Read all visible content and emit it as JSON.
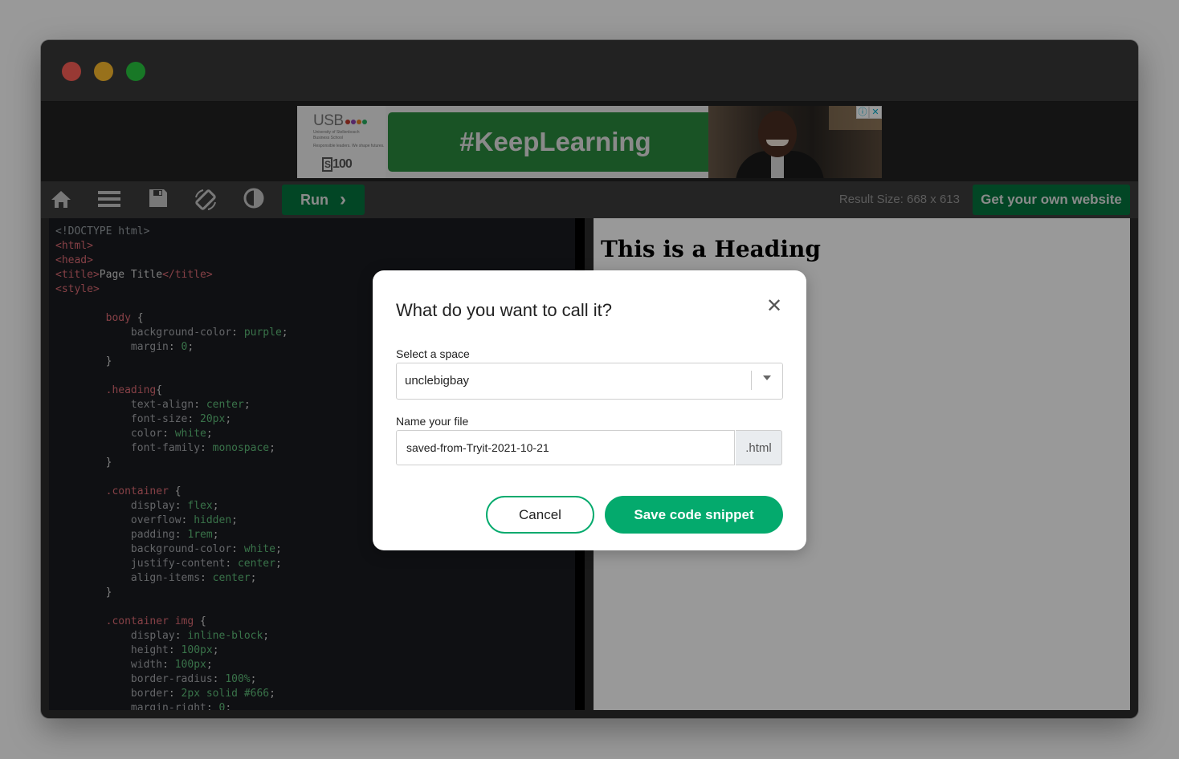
{
  "window": {
    "traffic_lights": [
      "close",
      "minimize",
      "zoom"
    ]
  },
  "ad": {
    "logo_text": "USB",
    "logo_subtext_1": "University of Stellenbosch",
    "logo_subtext_2": "Business School",
    "logo_tagline": "Responsible leaders. We shape futures.",
    "anniversary": "100",
    "headline": "#KeepLearning",
    "badge_info": "ⓘ",
    "badge_close": "✕"
  },
  "toolbar": {
    "icons": [
      "home-icon",
      "menu-icon",
      "save-icon",
      "rotate-icon",
      "contrast-icon"
    ],
    "run_label": "Run",
    "run_chevron": "›",
    "result_size": "Result Size: 668 x 613",
    "get_website_label": "Get your own website"
  },
  "editor": {
    "lines": [
      [
        [
          "g",
          "<!DOCTYPE html>"
        ]
      ],
      [
        [
          "r",
          "<html>"
        ]
      ],
      [
        [
          "r",
          "<head>"
        ]
      ],
      [
        [
          "r",
          "<title>"
        ],
        [
          "w",
          "Page Title"
        ],
        [
          "r",
          "</title>"
        ]
      ],
      [
        [
          "r",
          "<style>"
        ]
      ],
      [],
      [
        [
          "w",
          "        "
        ],
        [
          "r",
          "body"
        ],
        [
          "w",
          " {"
        ]
      ],
      [
        [
          "w",
          "            "
        ],
        [
          "p",
          "background-color"
        ],
        [
          "w",
          ": "
        ],
        [
          "v",
          "purple"
        ],
        [
          "w",
          ";"
        ]
      ],
      [
        [
          "w",
          "            "
        ],
        [
          "p",
          "margin"
        ],
        [
          "w",
          ": "
        ],
        [
          "v",
          "0"
        ],
        [
          "w",
          ";"
        ]
      ],
      [
        [
          "w",
          "        }"
        ]
      ],
      [],
      [
        [
          "w",
          "        "
        ],
        [
          "r",
          ".heading"
        ],
        [
          "w",
          "{"
        ]
      ],
      [
        [
          "w",
          "            "
        ],
        [
          "p",
          "text-align"
        ],
        [
          "w",
          ": "
        ],
        [
          "v",
          "center"
        ],
        [
          "w",
          ";"
        ]
      ],
      [
        [
          "w",
          "            "
        ],
        [
          "p",
          "font-size"
        ],
        [
          "w",
          ": "
        ],
        [
          "v",
          "20px"
        ],
        [
          "w",
          ";"
        ]
      ],
      [
        [
          "w",
          "            "
        ],
        [
          "p",
          "color"
        ],
        [
          "w",
          ": "
        ],
        [
          "v",
          "white"
        ],
        [
          "w",
          ";"
        ]
      ],
      [
        [
          "w",
          "            "
        ],
        [
          "p",
          "font-family"
        ],
        [
          "w",
          ": "
        ],
        [
          "v",
          "monospace"
        ],
        [
          "w",
          ";"
        ]
      ],
      [
        [
          "w",
          "        }"
        ]
      ],
      [],
      [
        [
          "w",
          "        "
        ],
        [
          "r",
          ".container"
        ],
        [
          "w",
          " {"
        ]
      ],
      [
        [
          "w",
          "            "
        ],
        [
          "p",
          "display"
        ],
        [
          "w",
          ": "
        ],
        [
          "v",
          "flex"
        ],
        [
          "w",
          ";"
        ]
      ],
      [
        [
          "w",
          "            "
        ],
        [
          "p",
          "overflow"
        ],
        [
          "w",
          ": "
        ],
        [
          "v",
          "hidden"
        ],
        [
          "w",
          ";"
        ]
      ],
      [
        [
          "w",
          "            "
        ],
        [
          "p",
          "padding"
        ],
        [
          "w",
          ": "
        ],
        [
          "v",
          "1rem"
        ],
        [
          "w",
          ";"
        ]
      ],
      [
        [
          "w",
          "            "
        ],
        [
          "p",
          "background-color"
        ],
        [
          "w",
          ": "
        ],
        [
          "v",
          "white"
        ],
        [
          "w",
          ";"
        ]
      ],
      [
        [
          "w",
          "            "
        ],
        [
          "p",
          "justify-content"
        ],
        [
          "w",
          ": "
        ],
        [
          "v",
          "center"
        ],
        [
          "w",
          ";"
        ]
      ],
      [
        [
          "w",
          "            "
        ],
        [
          "p",
          "align-items"
        ],
        [
          "w",
          ": "
        ],
        [
          "v",
          "center"
        ],
        [
          "w",
          ";"
        ]
      ],
      [
        [
          "w",
          "        }"
        ]
      ],
      [],
      [
        [
          "w",
          "        "
        ],
        [
          "r",
          ".container img"
        ],
        [
          "w",
          " {"
        ]
      ],
      [
        [
          "w",
          "            "
        ],
        [
          "p",
          "display"
        ],
        [
          "w",
          ": "
        ],
        [
          "v",
          "inline-block"
        ],
        [
          "w",
          ";"
        ]
      ],
      [
        [
          "w",
          "            "
        ],
        [
          "p",
          "height"
        ],
        [
          "w",
          ": "
        ],
        [
          "v",
          "100px"
        ],
        [
          "w",
          ";"
        ]
      ],
      [
        [
          "w",
          "            "
        ],
        [
          "p",
          "width"
        ],
        [
          "w",
          ": "
        ],
        [
          "v",
          "100px"
        ],
        [
          "w",
          ";"
        ]
      ],
      [
        [
          "w",
          "            "
        ],
        [
          "p",
          "border-radius"
        ],
        [
          "w",
          ": "
        ],
        [
          "v",
          "100%"
        ],
        [
          "w",
          ";"
        ]
      ],
      [
        [
          "w",
          "            "
        ],
        [
          "p",
          "border"
        ],
        [
          "w",
          ": "
        ],
        [
          "v",
          "2px solid #666"
        ],
        [
          "w",
          ";"
        ]
      ],
      [
        [
          "w",
          "            "
        ],
        [
          "p",
          "margin-right"
        ],
        [
          "w",
          ": "
        ],
        [
          "v",
          "0"
        ],
        [
          "w",
          ";"
        ]
      ]
    ],
    "colors": {
      "g": "#9aa0a6",
      "r": "#e06c75",
      "w": "#d4d4d4",
      "p": "#a7a9ad",
      "v": "#5fbf7a"
    }
  },
  "result": {
    "heading": "This is a Heading"
  },
  "modal": {
    "title": "What do you want to call it?",
    "close_icon": "✕",
    "space_label": "Select a space",
    "space_value": "unclebigbay",
    "file_label": "Name your file",
    "file_value": "saved-from-Tryit-2021-10-21",
    "file_ext": ".html",
    "cancel_label": "Cancel",
    "save_label": "Save code snippet"
  }
}
